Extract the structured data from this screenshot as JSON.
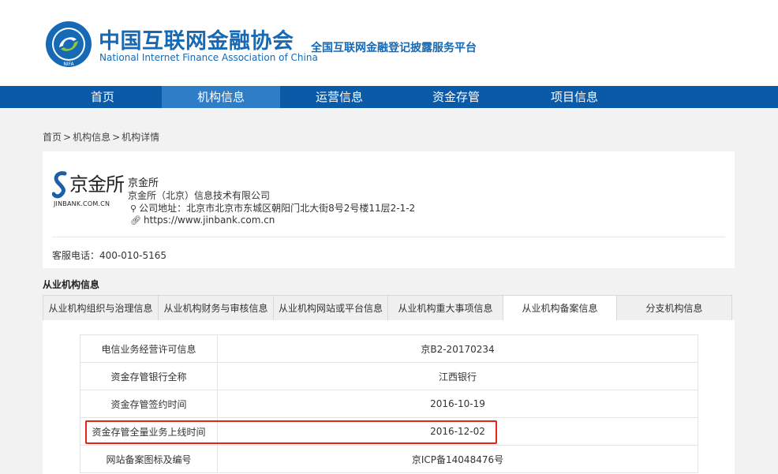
{
  "header": {
    "org_cn": "中国互联网金融协会",
    "org_en": "National Internet Finance Association of China",
    "platform": "全国互联网金融登记披露服务平台",
    "logo_text": "NIFA",
    "brand_color": "#1569b5"
  },
  "nav": {
    "items": [
      {
        "label": "首页"
      },
      {
        "label": "机构信息"
      },
      {
        "label": "运营信息"
      },
      {
        "label": "资金存管"
      },
      {
        "label": "项目信息"
      }
    ],
    "active_index": 1,
    "bg_color": "#0b5aa8",
    "active_color": "#2f7cc7"
  },
  "breadcrumb": {
    "items": [
      "首页",
      "机构信息",
      "机构详情"
    ],
    "separator": ">"
  },
  "institution": {
    "logo_name": "京金所",
    "logo_domain": "JINBANK.COM.CN",
    "short_name": "京金所",
    "full_name": "京金所（北京）信息技术有限公司",
    "address": "公司地址：北京市北京市东城区朝阳门北大街8号2号楼11层2-1-2",
    "address_icon": "location-pin-icon",
    "website": "https://www.jinbank.com.cn",
    "website_icon": "link-icon",
    "hotline": "客服电话：400-010-5165"
  },
  "section": {
    "title": "从业机构信息"
  },
  "tabs": {
    "items": [
      {
        "label": "从业机构组织与治理信息"
      },
      {
        "label": "从业机构财务与审核信息"
      },
      {
        "label": "从业机构网站或平台信息"
      },
      {
        "label": "从业机构重大事项信息"
      },
      {
        "label": "从业机构备案信息"
      },
      {
        "label": "分支机构信息"
      }
    ],
    "active_index": 4
  },
  "table": {
    "rows": [
      {
        "label": "电信业务经营许可信息",
        "value": "京B2-20170234"
      },
      {
        "label": "资金存管银行全称",
        "value": "江西银行"
      },
      {
        "label": "资金存管签约时间",
        "value": "2016-10-19"
      },
      {
        "label": "资金存管全量业务上线时间",
        "value": "2016-12-02"
      },
      {
        "label": "网站备案图标及编号",
        "value": "京ICP备14048476号"
      }
    ],
    "highlight_color": "#e0251b"
  }
}
